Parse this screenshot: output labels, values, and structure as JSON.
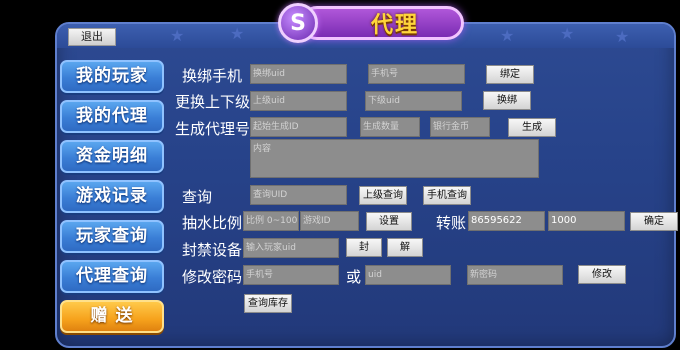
{
  "title": "代理",
  "title_icon_glyph": "S",
  "logout_label": "退出",
  "sidebar": {
    "items": [
      {
        "label": "我的玩家"
      },
      {
        "label": "我的代理"
      },
      {
        "label": "资金明细"
      },
      {
        "label": "游戏记录"
      },
      {
        "label": "玩家查询"
      },
      {
        "label": "代理查询"
      },
      {
        "label": "赠 送"
      }
    ],
    "active_index": 6
  },
  "form": {
    "change_phone": {
      "label": "换绑手机",
      "uid_placeholder": "换绑uid",
      "phone_placeholder": "手机号",
      "bind_label": "绑定"
    },
    "change_superior": {
      "label": "更换上下级",
      "upper_placeholder": "上级uid",
      "lower_placeholder": "下级uid",
      "rebind_label": "换绑"
    },
    "gen_agent": {
      "label": "生成代理号",
      "start_placeholder": "起始生成ID",
      "count_placeholder": "生成数量",
      "gold_placeholder": "银行金币",
      "generate_label": "生成",
      "content_placeholder": "内容"
    },
    "query": {
      "label": "查询",
      "uid_placeholder": "查询UID",
      "upper_query_label": "上级查询",
      "phone_query_label": "手机查询"
    },
    "rake": {
      "label": "抽水比例",
      "ratio_placeholder": "比例 0~100",
      "game_placeholder": "游戏ID",
      "set_label": "设置"
    },
    "transfer": {
      "label": "转账",
      "account_value": "86595622",
      "amount_value": "1000",
      "confirm_label": "确定"
    },
    "ban": {
      "label": "封禁设备",
      "uid_placeholder": "输入玩家uid",
      "ban_label": "封",
      "unban_label": "解"
    },
    "password": {
      "label": "修改密码",
      "phone_placeholder": "手机号",
      "or_label": "或",
      "uid_placeholder": "uid",
      "newpwd_placeholder": "新密码",
      "modify_label": "修改"
    },
    "inventory_label": "查询库存"
  },
  "colors": {
    "panel": "#27438a",
    "side_button": "#3a7ed6",
    "active_button": "#f6a21c",
    "title_text": "#ffd63a",
    "title_pill": "#7a2cb3"
  }
}
